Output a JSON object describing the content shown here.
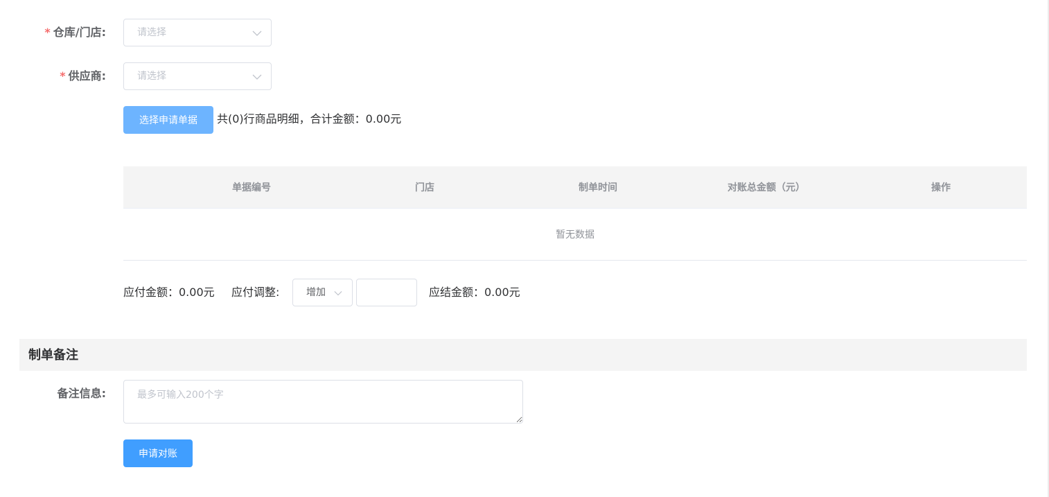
{
  "form": {
    "warehouse": {
      "required_mark": "*",
      "label": "仓库/门店:",
      "placeholder": "请选择"
    },
    "supplier": {
      "required_mark": "*",
      "label": "供应商:",
      "placeholder": "请选择"
    },
    "select_docs_button": "选择申请单据",
    "detail_summary": "共(0)行商品明细，合计金额：0.00元"
  },
  "table": {
    "columns": [
      "单据编号",
      "门店",
      "制单时间",
      "对账总金额（元）",
      "操作"
    ],
    "empty_text": "暂无数据"
  },
  "payment": {
    "payable_label": "应付金额：0.00元",
    "adjust_label": "应付调整:",
    "adjust_mode": "增加",
    "adjust_value": "",
    "settle_label": "应结金额：0.00元"
  },
  "remarks_section": {
    "title": "制单备注",
    "label": "备注信息:",
    "placeholder": "最多可输入200个字"
  },
  "submit_button": "申请对账",
  "colors": {
    "primary": "#409eff",
    "primary_light": "#66b1ff",
    "required": "#f56c6c",
    "header_bg": "#f4f4f4"
  }
}
